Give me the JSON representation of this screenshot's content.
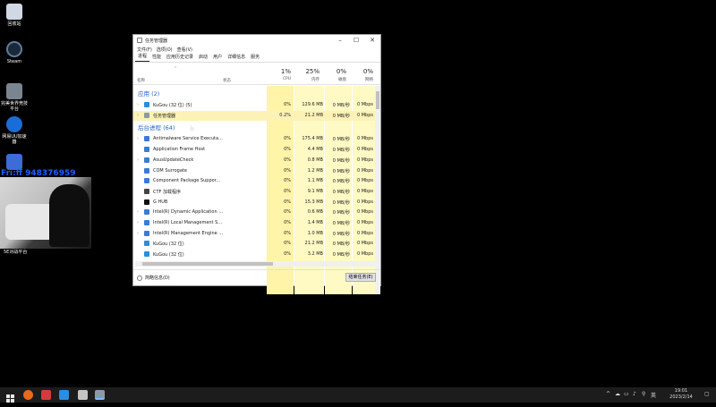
{
  "desktop": {
    "icons": [
      {
        "label": "回收站",
        "color": "#cfd8e3"
      },
      {
        "label": "Steam",
        "color": "#1b2838"
      },
      {
        "label": "完美世界竞技平台",
        "color": "#7a8590"
      },
      {
        "label": "网易UU加速器",
        "color": "#1a6dd6"
      },
      {
        "label": "",
        "color": "#3d6bd8"
      }
    ],
    "overlay_text": "Fri:ff 948376959",
    "cam_label": "5E对战平台"
  },
  "window": {
    "title": "任务管理器",
    "menu": [
      "文件(F)",
      "选项(O)",
      "查看(V)"
    ],
    "tabs": [
      "进程",
      "性能",
      "应用历史记录",
      "启动",
      "用户",
      "详细信息",
      "服务"
    ],
    "active_tab": 0,
    "columns": {
      "name": "名称",
      "status": "状态",
      "cpu_pct": "1%",
      "cpu": "CPU",
      "mem_pct": "25%",
      "mem": "内存",
      "disk_pct": "0%",
      "disk": "磁盘",
      "net_pct": "0%",
      "net": "网络"
    },
    "groups": [
      {
        "title": "应用 (2)",
        "rows": [
          {
            "expand": "›",
            "icon": "kugou-icon",
            "color": "#2a8de0",
            "name": "KuGou (32 位) (5)",
            "cpu": "0%",
            "mem": "129.6 MB",
            "disk": "0 MB/秒",
            "net": "0 Mbps"
          },
          {
            "expand": "›",
            "icon": "task-manager-icon",
            "color": "#8a9aa8",
            "name": "任务管理器",
            "cpu": "0.2%",
            "mem": "21.2 MB",
            "disk": "0 MB/秒",
            "net": "0 Mbps",
            "selected": true
          }
        ]
      },
      {
        "title": "后台进程 (64)",
        "rows": [
          {
            "expand": "›",
            "icon": "defender-icon",
            "color": "#3a7bd5",
            "name": "Antimalware Service Executa...",
            "cpu": "0%",
            "mem": "175.4 MB",
            "disk": "0 MB/秒",
            "net": "0 Mbps"
          },
          {
            "expand": "",
            "icon": "app-frame-icon",
            "color": "#3a7bd5",
            "name": "Application Frame Host",
            "cpu": "0%",
            "mem": "4.4 MB",
            "disk": "0 MB/秒",
            "net": "0 Mbps"
          },
          {
            "expand": "›",
            "icon": "asus-icon",
            "color": "#3a7bd5",
            "name": "AsusUpdateCheck",
            "cpu": "0%",
            "mem": "0.8 MB",
            "disk": "0 MB/秒",
            "net": "0 Mbps"
          },
          {
            "expand": "",
            "icon": "com-icon",
            "color": "#3a7bd5",
            "name": "COM Surrogate",
            "cpu": "0%",
            "mem": "1.2 MB",
            "disk": "0 MB/秒",
            "net": "0 Mbps"
          },
          {
            "expand": "",
            "icon": "component-icon",
            "color": "#3a7bd5",
            "name": "Component Package Suppor...",
            "cpu": "0%",
            "mem": "1.1 MB",
            "disk": "0 MB/秒",
            "net": "0 Mbps"
          },
          {
            "expand": "",
            "icon": "ctf-icon",
            "color": "#444444",
            "name": "CTF 加载程序",
            "cpu": "0%",
            "mem": "9.1 MB",
            "disk": "0 MB/秒",
            "net": "0 Mbps"
          },
          {
            "expand": "",
            "icon": "ghub-icon",
            "color": "#111111",
            "name": "G HUB",
            "cpu": "0%",
            "mem": "15.3 MB",
            "disk": "0 MB/秒",
            "net": "0 Mbps"
          },
          {
            "expand": "›",
            "icon": "intel-icon",
            "color": "#3a7bd5",
            "name": "Intel(R) Dynamic Application ...",
            "cpu": "0%",
            "mem": "0.6 MB",
            "disk": "0 MB/秒",
            "net": "0 Mbps"
          },
          {
            "expand": "›",
            "icon": "intel-icon",
            "color": "#3a7bd5",
            "name": "Intel(R) Local Management S...",
            "cpu": "0%",
            "mem": "1.4 MB",
            "disk": "0 MB/秒",
            "net": "0 Mbps"
          },
          {
            "expand": "›",
            "icon": "intel-icon",
            "color": "#3a7bd5",
            "name": "Intel(R) Management Engine ...",
            "cpu": "0%",
            "mem": "1.0 MB",
            "disk": "0 MB/秒",
            "net": "0 Mbps"
          },
          {
            "expand": "",
            "icon": "kugou-icon",
            "color": "#2a8de0",
            "name": "KuGou (32 位)",
            "cpu": "0%",
            "mem": "21.2 MB",
            "disk": "0 MB/秒",
            "net": "0 Mbps"
          },
          {
            "expand": "",
            "icon": "kugou-icon",
            "color": "#2a8de0",
            "name": "KuGou (32 位)",
            "cpu": "0%",
            "mem": "3.2 MB",
            "disk": "0 MB/秒",
            "net": "0 Mbps"
          }
        ]
      }
    ],
    "fewer_details": "简略信息(D)",
    "end_task": "结束任务(E)"
  },
  "taskbar": {
    "time": "19:01",
    "date": "2023/2/14",
    "ime": "英",
    "tray_icons": [
      "^",
      "☁",
      "▭",
      "♪",
      "⚲"
    ],
    "apps": [
      {
        "name": "start-icon",
        "color": "#e9e9e9"
      },
      {
        "name": "firefox-icon",
        "color": "#e66a1b"
      },
      {
        "name": "app-icon",
        "color": "#d23c3c"
      },
      {
        "name": "kugou-icon",
        "color": "#2a8de0"
      },
      {
        "name": "app2-icon",
        "color": "#c4c4c4"
      },
      {
        "name": "taskmgr-icon",
        "color": "#8a9aa8"
      }
    ]
  }
}
